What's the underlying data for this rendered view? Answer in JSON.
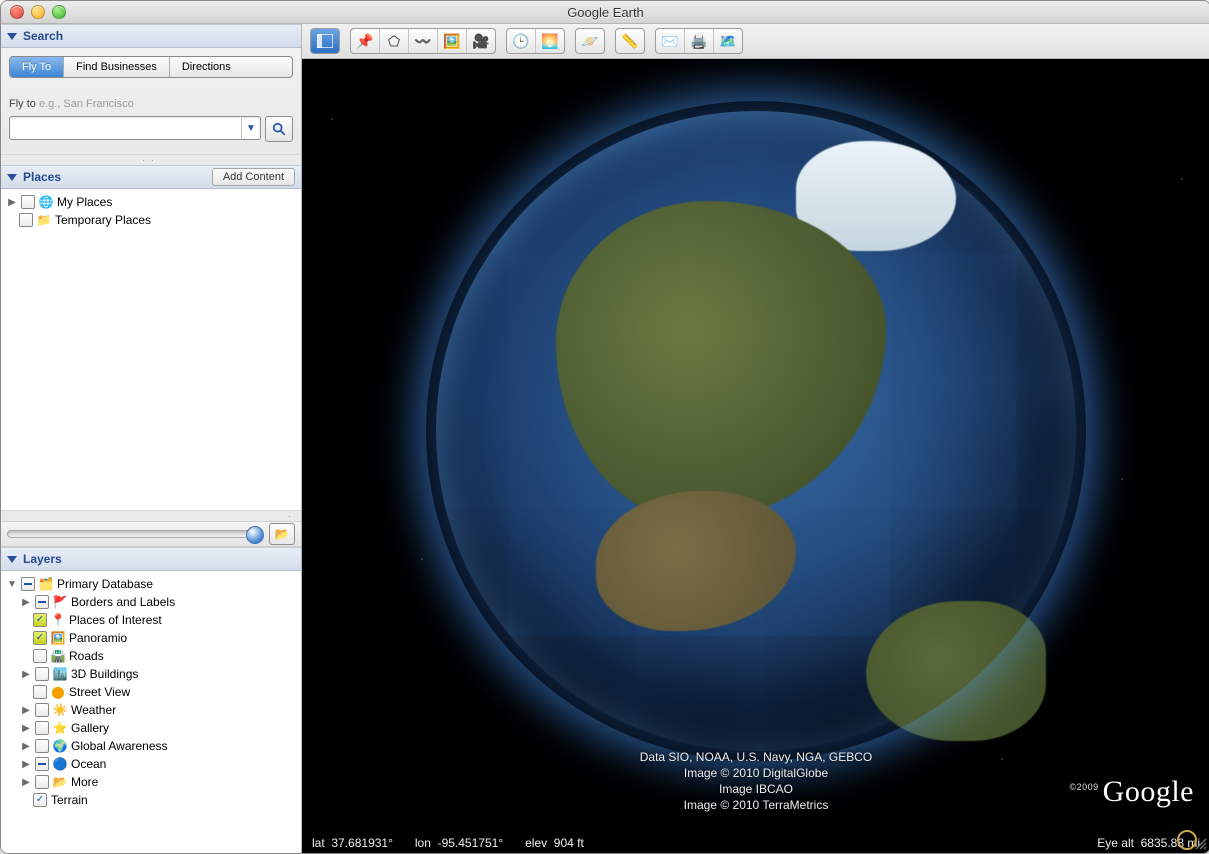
{
  "window": {
    "title": "Google Earth"
  },
  "sidebar": {
    "search": {
      "title": "Search",
      "tabs": {
        "fly_to": "Fly To",
        "find_businesses": "Find Businesses",
        "directions": "Directions"
      },
      "flyto_prefix": "Fly to ",
      "flyto_hint": "e.g., San Francisco",
      "input_value": ""
    },
    "places": {
      "title": "Places",
      "add_content": "Add Content",
      "items": [
        {
          "label": "My Places"
        },
        {
          "label": "Temporary Places"
        }
      ]
    },
    "layers": {
      "title": "Layers",
      "root": "Primary Database",
      "items": [
        {
          "label": "Borders and Labels"
        },
        {
          "label": "Places of Interest"
        },
        {
          "label": "Panoramio"
        },
        {
          "label": "Roads"
        },
        {
          "label": "3D Buildings"
        },
        {
          "label": "Street View"
        },
        {
          "label": "Weather"
        },
        {
          "label": "Gallery"
        },
        {
          "label": "Global Awareness"
        },
        {
          "label": "Ocean"
        },
        {
          "label": "More"
        },
        {
          "label": "Terrain"
        }
      ]
    }
  },
  "attribution": {
    "l1": "Data SIO, NOAA, U.S. Navy, NGA, GEBCO",
    "l2": "Image © 2010 DigitalGlobe",
    "l3": "Image IBCAO",
    "l4": "Image © 2010 TerraMetrics"
  },
  "status": {
    "lat_label": "lat",
    "lat": "37.681931°",
    "lon_label": "lon",
    "lon": "-95.451751°",
    "elev_label": "elev",
    "elev": "904 ft",
    "eye_label": "Eye alt",
    "eye": "6835.88 mi"
  },
  "logo": {
    "year": "©2009",
    "text": "Google"
  }
}
